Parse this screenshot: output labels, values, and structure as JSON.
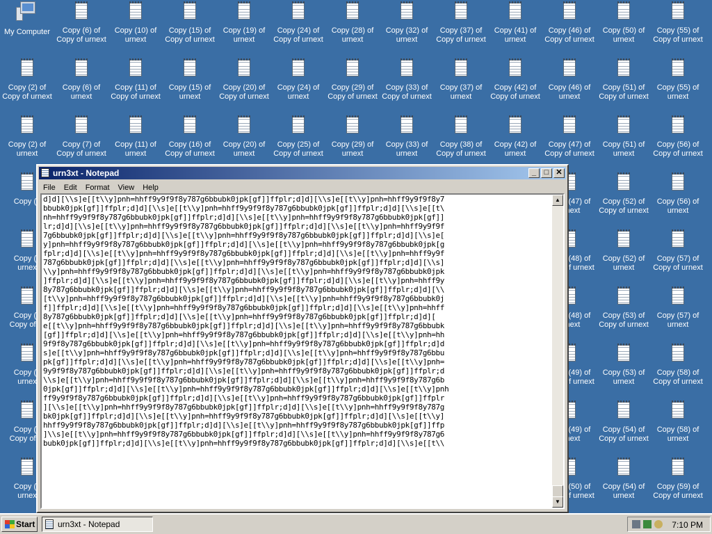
{
  "desktop": {
    "my_computer_label": "My Computer",
    "icons": [
      "Copy (6) of\nCopy of urnext",
      "Copy (10) of\nurnext",
      "Copy (15) of\nCopy of urnext",
      "Copy (19) of\nurnext",
      "Copy (24) of\nCopy of urnext",
      "Copy (28) of\nurnext",
      "Copy (32) of\nurnext",
      "Copy (37) of\nCopy of urnext",
      "Copy (41) of\nurnext",
      "Copy (46) of\nCopy of urnext",
      "Copy (50) of\nurnext",
      "Copy (55) of\nCopy of urnext",
      "Copy (2) of\nCopy of urnext",
      "Copy (6) of\nurnext",
      "Copy (11) of\nCopy of urnext",
      "Copy (15) of\nurnext",
      "Copy (20) of\nCopy of urnext",
      "Copy (24) of\nurnext",
      "Copy (29) of\nCopy of urnext",
      "Copy (33) of\nCopy of urnext",
      "Copy (37) of\nurnext",
      "Copy (42) of\nCopy of urnext",
      "Copy (46) of\nurnext",
      "Copy (51) of\nCopy of urnext",
      "Copy (55) of\nurnext",
      "Copy (2) of\nurnext",
      "Copy (7) of\nCopy of urnext",
      "Copy (11) of\nurnext",
      "Copy (16) of\nCopy of urnext",
      "Copy (20) of\nurnext",
      "Copy (25) of\nCopy of urnext",
      "Copy (29) of\nurnext",
      "Copy (33) of\nurnext",
      "Copy (38) of\nCopy of urnext",
      "Copy (42) of\nurnext",
      "Copy (47) of\nCopy of urnext",
      "Copy (51) of\nurnext",
      "Copy (56) of\nCopy of urnext",
      "Copy (3",
      "Copy (47) of\nurnext",
      "Copy (52) of\nCopy of urnext",
      "Copy (56) of\nurnext",
      "Copy (3\nurnex",
      "Copy (48) of\nCopy of urnext",
      "Copy (52) of\nurnext",
      "Copy (57) of\nCopy of urnext",
      "Copy (4\nCopy of ur",
      "Copy (48) of\nurnext",
      "Copy (53) of\nCopy of urnext",
      "Copy (57) of\nurnext",
      "Copy (4\nurnex",
      "Copy (49) of\nCopy of urnext",
      "Copy (53) of\nurnext",
      "Copy (58) of\nCopy of urnext",
      "Copy (5\nCopy of ur",
      "Copy (49) of\nurnext",
      "Copy (54) of\nCopy of urnext",
      "Copy (58) of\nurnext",
      "Copy (5\nurnex",
      "Copy (50) of\nCopy of urnext",
      "Copy (54) of\nurnext",
      "Copy (59) of\nCopy of urnext"
    ]
  },
  "notepad": {
    "title": "urn3xt - Notepad",
    "menu": [
      "File",
      "Edit",
      "Format",
      "View",
      "Help"
    ],
    "lines": [
      "d]d][\\\\s]e[[t\\\\y]pnh=hhff9y9f9f8y787g6bbubk0jpk[gf]]ffplr;d]d][\\\\s]e[[t\\\\y]pnh=hhff9y9f9f8y7",
      "bbubk0jpk[gf]]ffplr;d]d][\\\\s]e[[t\\\\y]pnh=hhff9y9f9f8y787g6bbubk0jpk[gf]]ffplr;d]d][\\\\s]e[[t\\",
      "nh=hhff9y9f9f8y787g6bbubk0jpk[gf]]ffplr;d]d][\\\\s]e[[t\\\\y]pnh=hhff9y9f9f8y787g6bbubk0jpk[gf]]",
      "lr;d]d][\\\\s]e[[t\\\\y]pnh=hhff9y9f9f8y787g6bbubk0jpk[gf]]ffplr;d]d][\\\\s]e[[t\\\\y]pnh=hhff9y9f9f",
      "7g6bbubk0jpk[gf]]ffplr;d]d][\\\\s]e[[t\\\\y]pnh=hhff9y9f9f8y787g6bbubk0jpk[gf]]ffplr;d]d][\\\\s]e[",
      "y]pnh=hhff9y9f9f8y787g6bbubk0jpk[gf]]ffplr;d]d][\\\\s]e[[t\\\\y]pnh=hhff9y9f9f8y787g6bbubk0jpk[g",
      "fplr;d]d][\\\\s]e[[t\\\\y]pnh=hhff9y9f9f8y787g6bbubk0jpk[gf]]ffplr;d]d][\\\\s]e[[t\\\\y]pnh=hhff9y9f",
      "787g6bbubk0jpk[gf]]ffplr;d]d][\\\\s]e[[t\\\\y]pnh=hhff9y9f9f8y787g6bbubk0jpk[gf]]ffplr;d]d][\\\\s]",
      "\\\\y]pnh=hhff9y9f9f8y787g6bbubk0jpk[gf]]ffplr;d]d][\\\\s]e[[t\\\\y]pnh=hhff9y9f9f8y787g6bbubk0jpk",
      "]ffplr;d]d][\\\\s]e[[t\\\\y]pnh=hhff9y9f9f8y787g6bbubk0jpk[gf]]ffplr;d]d][\\\\s]e[[t\\\\y]pnh=hhff9y",
      "8y787g6bbubk0jpk[gf]]ffplr;d]d][\\\\s]e[[t\\\\y]pnh=hhff9y9f9f8y787g6bbubk0jpk[gf]]ffplr;d]d][\\\\",
      "[t\\\\y]pnh=hhff9y9f9f8y787g6bbubk0jpk[gf]]ffplr;d]d][\\\\s]e[[t\\\\y]pnh=hhff9y9f9f8y787g6bbubk0j",
      "f]]ffplr;d]d][\\\\s]e[[t\\\\y]pnh=hhff9y9f9f8y787g6bbubk0jpk[gf]]ffplr;d]d][\\\\s]e[[t\\\\y]pnh=hhff",
      "8y787g6bbubk0jpk[gf]]ffplr;d]d][\\\\s]e[[t\\\\y]pnh=hhff9y9f9f8y787g6bbubk0jpk[gf]]ffplr;d]d][",
      "e[[t\\\\y]pnh=hhff9y9f9f8y787g6bbubk0jpk[gf]]ffplr;d]d][\\\\s]e[[t\\\\y]pnh=hhff9y9f9f8y787g6bbubk",
      "[gf]]ffplr;d]d][\\\\s]e[[t\\\\y]pnh=hhff9y9f9f8y787g6bbubk0jpk[gf]]ffplr;d]d][\\\\s]e[[t\\\\y]pnh=hh",
      "9f9f8y787g6bbubk0jpk[gf]]ffplr;d]d][\\\\s]e[[t\\\\y]pnh=hhff9y9f9f8y787g6bbubk0jpk[gf]]ffplr;d]d",
      "s]e[[t\\\\y]pnh=hhff9y9f9f8y787g6bbubk0jpk[gf]]ffplr;d]d][\\\\s]e[[t\\\\y]pnh=hhff9y9f9f8y787g6bbu",
      "pk[gf]]ffplr;d]d][\\\\s]e[[t\\\\y]pnh=hhff9y9f9f8y787g6bbubk0jpk[gf]]ffplr;d]d][\\\\s]e[[t\\\\y]pnh=",
      "9y9f9f8y787g6bbubk0jpk[gf]]ffplr;d]d][\\\\s]e[[t\\\\y]pnh=hhff9y9f9f8y787g6bbubk0jpk[gf]]ffplr;d",
      "\\\\s]e[[t\\\\y]pnh=hhff9y9f9f8y787g6bbubk0jpk[gf]]ffplr;d]d][\\\\s]e[[t\\\\y]pnh=hhff9y9f9f8y787g6b",
      "0jpk[gf]]ffplr;d]d][\\\\s]e[[t\\\\y]pnh=hhff9y9f9f8y787g6bbubk0jpk[gf]]ffplr;d]d][\\\\s]e[[t\\\\y]pnh",
      "ff9y9f9f8y787g6bbubk0jpk[gf]]ffplr;d]d][\\\\s]e[[t\\\\y]pnh=hhff9y9f9f8y787g6bbubk0jpk[gf]]ffplr",
      "][\\\\s]e[[t\\\\y]pnh=hhff9y9f9f8y787g6bbubk0jpk[gf]]ffplr;d]d][\\\\s]e[[t\\\\y]pnh=hhff9y9f9f8y787g",
      "bk0jpk[gf]]ffplr;d]d][\\\\s]e[[t\\\\y]pnh=hhff9y9f9f8y787g6bbubk0jpk[gf]]ffplr;d]d][\\\\s]e[[t\\\\y]",
      "hhff9y9f9f8y787g6bbubk0jpk[gf]]ffplr;d]d][\\\\s]e[[t\\\\y]pnh=hhff9y9f9f8y787g6bbubk0jpk[gf]]ffp",
      "]\\\\s]e[[t\\\\y]pnh=hhff9y9f9f8y787g6bbubk0jpk[gf]]ffplr;d]d][\\\\s]e[[t\\\\y]pnh=hhff9y9f9f8y787g6",
      "bubk0jpk[gf]]ffplr;d]d][\\\\s]e[[t\\\\y]pnh=hhff9y9f9f8y787g6bbubk0jpk[gf]]ffplr;d]d][\\\\s]e[[t\\\\"
    ]
  },
  "taskbar": {
    "start_label": "Start",
    "task_label": "urn3xt - Notepad",
    "clock": "7:10 PM"
  }
}
